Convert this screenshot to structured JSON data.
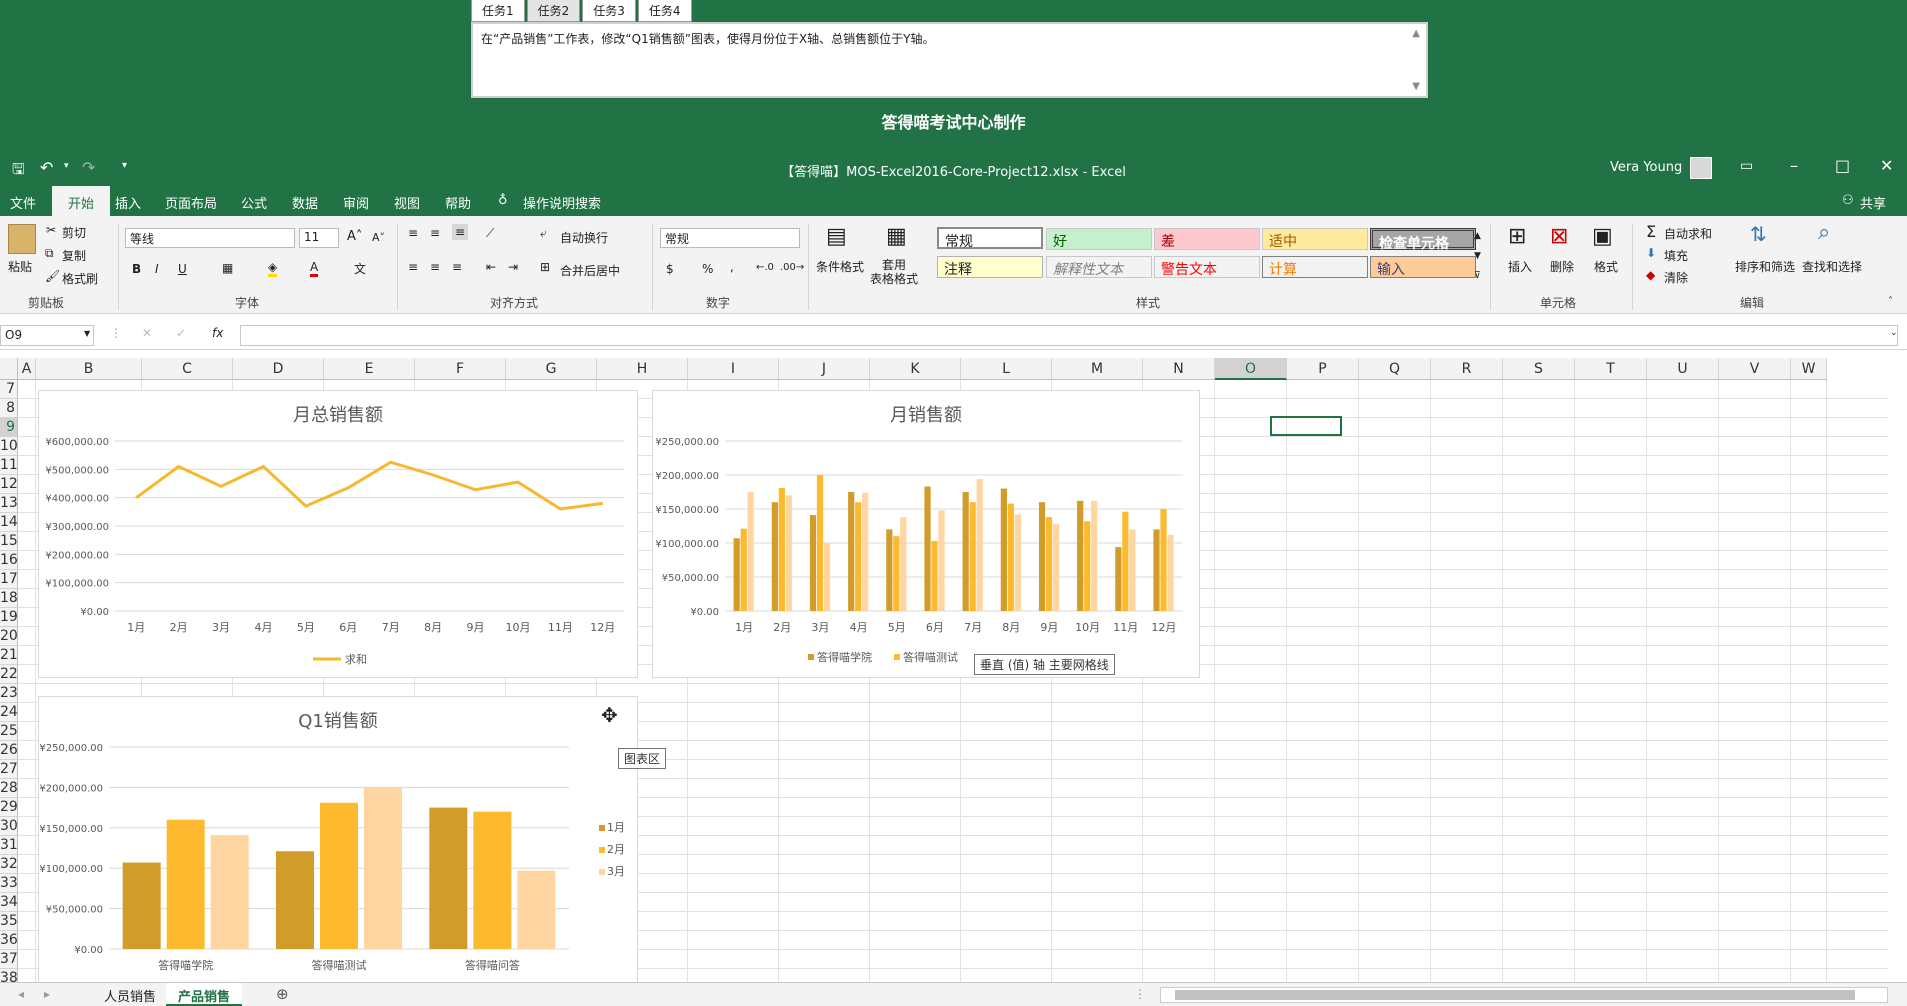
{
  "task_panel": {
    "tabs": [
      "任务1",
      "任务2",
      "任务3",
      "任务4"
    ],
    "active_tab": 1,
    "instruction": "在“产品销售”工作表，修改“Q1销售额”图表，使得月份位于X轴、总销售额位于Y轴。",
    "footer": "答得喵考试中心制作"
  },
  "window": {
    "title": "【答得喵】MOS-Excel2016-Core-Project12.xlsx  -  Excel",
    "user": "Vera Young"
  },
  "menu": {
    "items": [
      "文件",
      "开始",
      "插入",
      "页面布局",
      "公式",
      "数据",
      "审阅",
      "视图",
      "帮助"
    ],
    "active": "开始",
    "search": "操作说明搜索",
    "share": "共享"
  },
  "ribbon": {
    "clipboard": {
      "paste": "粘贴",
      "cut": "剪切",
      "copy": "复制",
      "format_painter": "格式刷",
      "label": "剪贴板"
    },
    "font": {
      "name": "等线",
      "size": "11",
      "label": "字体"
    },
    "alignment": {
      "wrap": "自动换行",
      "merge": "合并后居中",
      "label": "对齐方式"
    },
    "number": {
      "format": "常规",
      "label": "数字"
    },
    "styles": {
      "conditional": "条件格式",
      "table": "套用\n表格格式",
      "items": [
        "常规",
        "好",
        "差",
        "适中",
        "检查单元格",
        "注释",
        "解释性文本",
        "警告文本",
        "计算",
        "输入"
      ],
      "label": "样式"
    },
    "cells": {
      "insert": "插入",
      "delete": "删除",
      "format": "格式",
      "label": "单元格"
    },
    "editing": {
      "autosum": "自动求和",
      "fill": "填充",
      "clear": "清除",
      "sort": "排序和筛选",
      "find": "查找和选择",
      "label": "编辑"
    }
  },
  "formula_bar": {
    "name_box": "O9",
    "formula": ""
  },
  "columns": [
    "A",
    "B",
    "C",
    "D",
    "E",
    "F",
    "G",
    "H",
    "I",
    "J",
    "K",
    "L",
    "M",
    "N",
    "O",
    "P",
    "Q",
    "R",
    "S",
    "T",
    "U",
    "V",
    "W"
  ],
  "rows": [
    "7",
    "8",
    "9",
    "10",
    "11",
    "12",
    "13",
    "14",
    "15",
    "16",
    "17",
    "18",
    "19",
    "20",
    "21",
    "22",
    "23",
    "24",
    "25",
    "26",
    "27",
    "28",
    "29",
    "30",
    "31",
    "32",
    "33",
    "34",
    "35",
    "36",
    "37",
    "38"
  ],
  "chart_data": [
    {
      "type": "line",
      "title": "月总销售额",
      "categories": [
        "1月",
        "2月",
        "3月",
        "4月",
        "5月",
        "6月",
        "7月",
        "8月",
        "9月",
        "10月",
        "11月",
        "12月"
      ],
      "series": [
        {
          "name": "求和",
          "values": [
            400000,
            510000,
            440000,
            510000,
            370000,
            435000,
            525000,
            480000,
            428000,
            455000,
            360000,
            380000
          ]
        }
      ],
      "ylim": [
        0,
        600000
      ],
      "yticks": [
        "¥0.00",
        "¥100,000.00",
        "¥200,000.00",
        "¥300,000.00",
        "¥400,000.00",
        "¥500,000.00",
        "¥600,000.00"
      ],
      "legend": "bottom",
      "grid": true,
      "colors": [
        "#F6B92E"
      ]
    },
    {
      "type": "bar",
      "title": "月销售额",
      "categories": [
        "1月",
        "2月",
        "3月",
        "4月",
        "5月",
        "6月",
        "7月",
        "8月",
        "9月",
        "10月",
        "11月",
        "12月"
      ],
      "series": [
        {
          "name": "答得喵学院",
          "values": [
            107000,
            160000,
            141000,
            175000,
            120000,
            183000,
            175000,
            180000,
            160000,
            162000,
            94000,
            120000
          ]
        },
        {
          "name": "答得喵测试",
          "values": [
            121000,
            181000,
            200000,
            160000,
            110000,
            103000,
            160000,
            158000,
            138000,
            132000,
            146000,
            150000
          ]
        },
        {
          "name": "",
          "values": [
            175000,
            170000,
            100000,
            174000,
            138000,
            148000,
            194000,
            142000,
            128000,
            162000,
            120000,
            112000
          ]
        }
      ],
      "ylim": [
        0,
        250000
      ],
      "yticks": [
        "¥0.00",
        "¥50,000.00",
        "¥100,000.00",
        "¥150,000.00",
        "¥200,000.00",
        "¥250,000.00"
      ],
      "legend": "bottom",
      "grid": true,
      "colors": [
        "#D29C2A",
        "#FDBA2E",
        "#FFD6A1"
      ]
    },
    {
      "type": "bar",
      "title": "Q1销售额",
      "categories": [
        "答得喵学院",
        "答得喵测试",
        "答得喵问答"
      ],
      "series": [
        {
          "name": "1月",
          "values": [
            107000,
            121000,
            175000
          ]
        },
        {
          "name": "2月",
          "values": [
            160000,
            181000,
            170000
          ]
        },
        {
          "name": "3月",
          "values": [
            141000,
            200000,
            97000
          ]
        }
      ],
      "ylim": [
        0,
        250000
      ],
      "yticks": [
        "¥0.00",
        "¥50,000.00",
        "¥100,000.00",
        "¥150,000.00",
        "¥200,000.00",
        "¥250,000.00"
      ],
      "legend": "right",
      "grid": true,
      "colors": [
        "#D29C2A",
        "#FDBA2E",
        "#FFD6A1"
      ]
    }
  ],
  "tooltips": {
    "gridline": "垂直 (值) 轴 主要网格线",
    "chart_area": "图表区"
  },
  "sheets": [
    "人员销售",
    "产品销售"
  ],
  "active_sheet": "产品销售",
  "colors": {
    "excel_green": "#217346"
  }
}
